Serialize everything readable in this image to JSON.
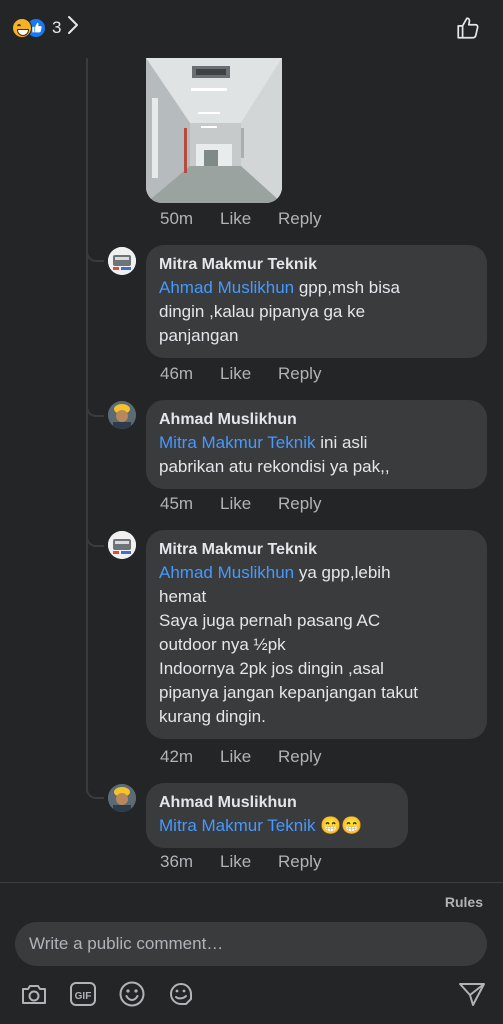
{
  "header": {
    "reaction_count": "3",
    "reaction_icons": [
      "laughing-face-emoji",
      "blue-like-icon"
    ]
  },
  "photo_comment": {
    "time": "50m",
    "like_label": "Like",
    "reply_label": "Reply"
  },
  "comments": [
    {
      "author": "Mitra Makmur Teknik",
      "mention": "Ahmad Muslikhun",
      "text": " gpp,msh bisa\ndingin ,kalau pipanya ga ke\npanjangan",
      "time": "46m",
      "like_label": "Like",
      "reply_label": "Reply"
    },
    {
      "author": "Ahmad Muslikhun",
      "mention": "Mitra Makmur Teknik",
      "text": "  ini asli\npabrikan atu rekondisi ya pak,,",
      "time": "45m",
      "like_label": "Like",
      "reply_label": "Reply"
    },
    {
      "author": "Mitra Makmur Teknik",
      "mention": "Ahmad Muslikhun",
      "text": " ya gpp,lebih\nhemat\nSaya juga pernah pasang AC\noutdoor nya ½pk\nIndoornya 2pk jos dingin ,asal\npipanya jangan kepanjangan takut\nkurang dingin.",
      "time": "42m",
      "like_label": "Like",
      "reply_label": "Reply"
    },
    {
      "author": "Ahmad Muslikhun",
      "mention": "Mitra Makmur Teknik",
      "text": " 😁😁",
      "time": "36m",
      "like_label": "Like",
      "reply_label": "Reply"
    }
  ],
  "footer": {
    "rules_label": "Rules",
    "comment_placeholder": "Write a public comment…",
    "tool_icons": [
      "camera-icon",
      "gif-icon",
      "emoji-icon",
      "sticker-icon",
      "send-icon"
    ]
  },
  "colors": {
    "background": "#242526",
    "bubble": "#3a3b3c",
    "mention": "#4599ff",
    "secondary_text": "#b0b3b8"
  }
}
